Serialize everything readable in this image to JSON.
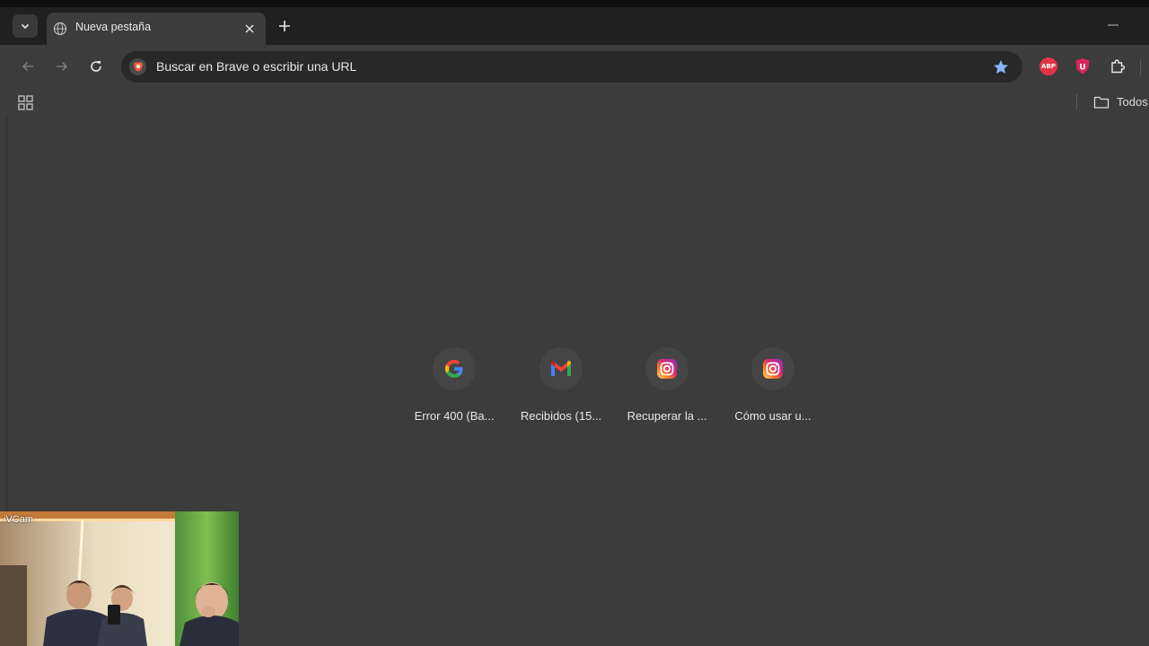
{
  "tab": {
    "title": "Nueva pestaña"
  },
  "omnibox": {
    "placeholder": "Buscar en Brave o escribir una URL"
  },
  "extensions": {
    "adblock_label": "ABP",
    "ublock_label": "U"
  },
  "bookmarks": {
    "folder_label": "Todos"
  },
  "shortcuts": [
    {
      "label": "Error 400 (Ba...",
      "icon": "google-icon"
    },
    {
      "label": "Recibidos (15...",
      "icon": "gmail-icon"
    },
    {
      "label": "Recuperar la ...",
      "icon": "instagram-icon"
    },
    {
      "label": "Cómo usar u...",
      "icon": "instagram-icon"
    }
  ],
  "webcam": {
    "label": "iVCam"
  },
  "colors": {
    "background": "#3c3c3c",
    "tabbar": "#202020",
    "omnibox": "#282828",
    "star": "#8ab4f8",
    "abp": "#e43444",
    "ublock": "#d5265c"
  }
}
